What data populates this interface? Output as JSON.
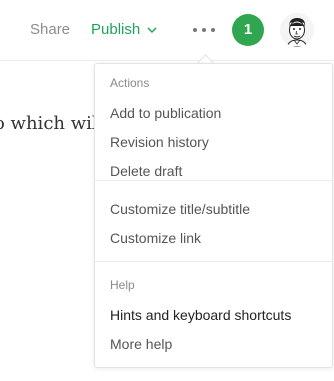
{
  "topbar": {
    "share_label": "Share",
    "publish_label": "Publish",
    "notification_count": "1"
  },
  "article": {
    "visible_text": "o which wil"
  },
  "menu": {
    "actions": {
      "title": "Actions",
      "items": [
        "Add to publication",
        "Revision history",
        "Delete draft"
      ]
    },
    "customize": {
      "items": [
        "Customize title/subtitle",
        "Customize link"
      ]
    },
    "help": {
      "title": "Help",
      "items": [
        "Hints and keyboard shortcuts",
        "More help"
      ]
    }
  },
  "colors": {
    "publish_green": "#1fa35a",
    "badge_green": "#2fa64f"
  }
}
